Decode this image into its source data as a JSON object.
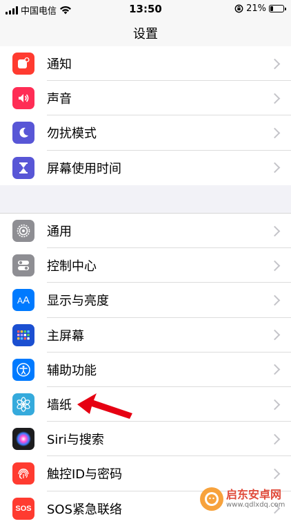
{
  "status_bar": {
    "carrier": "中国电信",
    "time": "13:50",
    "battery_text": "21%",
    "battery_level": 0.21
  },
  "nav": {
    "title": "设置"
  },
  "group1": [
    {
      "label": "通知",
      "icon": "notifications-icon",
      "color": "#ff3b30"
    },
    {
      "label": "声音",
      "icon": "sound-icon",
      "color": "#ff2d55"
    },
    {
      "label": "勿扰模式",
      "icon": "moon-icon",
      "color": "#5856d6"
    },
    {
      "label": "屏幕使用时间",
      "icon": "hourglass-icon",
      "color": "#5856d6"
    }
  ],
  "group2": [
    {
      "label": "通用",
      "icon": "gear-icon",
      "color": "#8e8e93"
    },
    {
      "label": "控制中心",
      "icon": "toggle-icon",
      "color": "#8e8e93"
    },
    {
      "label": "显示与亮度",
      "icon": "display-aa-icon",
      "color": "#007aff"
    },
    {
      "label": "主屏幕",
      "icon": "home-screen-grid-icon",
      "color": "#1b4fd1"
    },
    {
      "label": "辅助功能",
      "icon": "accessibility-icon",
      "color": "#007aff"
    },
    {
      "label": "墙纸",
      "icon": "wallpaper-flower-icon",
      "color": "#35aadc"
    },
    {
      "label": "Siri与搜索",
      "icon": "siri-icon",
      "color": "#1c1c1e"
    },
    {
      "label": "触控ID与密码",
      "icon": "fingerprint-icon",
      "color": "#ff3b30"
    },
    {
      "label": "SOS紧急联络",
      "icon": "sos-icon",
      "color": "#ff3b30"
    }
  ],
  "annotation": {
    "arrow_color": "#e60012"
  },
  "watermark": {
    "title": "启东安卓网",
    "url": "www.qdlxdq.com"
  }
}
